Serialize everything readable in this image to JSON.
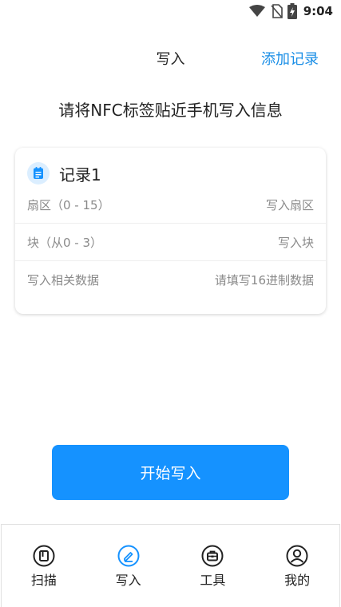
{
  "status": {
    "time": "9:04"
  },
  "header": {
    "title": "写入",
    "action": "添加记录"
  },
  "instruction": "请将NFC标签贴近手机写入信息",
  "record": {
    "title": "记录1",
    "rows": [
      {
        "label": "扇区（0 - 15）",
        "placeholder": "写入扇区"
      },
      {
        "label": "块（从0 - 3）",
        "placeholder": "写入块"
      },
      {
        "label": "写入相关数据",
        "placeholder": "请填写16进制数据"
      }
    ]
  },
  "start_button": "开始写入",
  "nav": {
    "items": [
      {
        "label": "扫描",
        "icon": "scan-icon"
      },
      {
        "label": "写入",
        "icon": "write-icon",
        "active": true
      },
      {
        "label": "工具",
        "icon": "toolbox-icon"
      },
      {
        "label": "我的",
        "icon": "profile-icon"
      }
    ]
  },
  "colors": {
    "accent": "#1592ff",
    "link": "#1a8ee6",
    "active_icon": "#1592ff"
  }
}
